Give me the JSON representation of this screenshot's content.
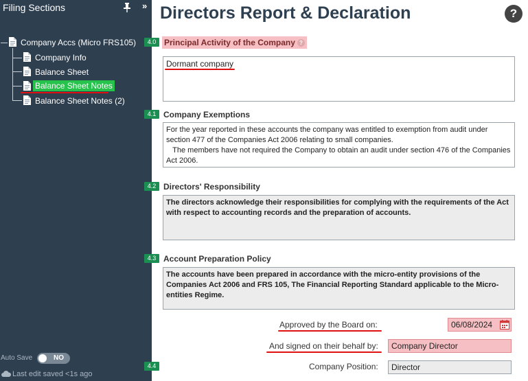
{
  "sidebar": {
    "title": "Filing Sections",
    "collapse_glyph": "»",
    "root": "Company Accs (Micro FRS105)",
    "items": [
      {
        "label": "Company Info"
      },
      {
        "label": "Balance Sheet"
      },
      {
        "label": "Balance Sheet Notes",
        "selected": true
      },
      {
        "label": "Balance Sheet Notes (2)"
      }
    ],
    "auto_save_label": "Auto Save",
    "auto_save_state": "NO",
    "last_saved": "Last edit saved <1s ago"
  },
  "header": {
    "title": "Directors Report & Declaration",
    "help_glyph": "?"
  },
  "sections": [
    {
      "num": "4.0",
      "title": "Principal Activity of the Company",
      "value": "Dormant company"
    },
    {
      "num": "4.1",
      "title": "Company Exemptions",
      "value": "For the year reported in these accounts the company was entitled to exemption from audit under section 477 of the Companies Act 2006 relating to small companies.\n   The members have not required the Company to obtain an audit under section 476 of the Companies Act 2006."
    },
    {
      "num": "4.2",
      "title": "Directors' Responsibility",
      "value": "The directors acknowledge their responsibilities for complying with the requirements of the Act with respect to accounting records and the preparation of accounts."
    },
    {
      "num": "4.3",
      "title": "Account Preparation Policy",
      "value": "The accounts have been prepared in accordance with the micro-entity provisions of the Companies Act 2006 and FRS 105, The Financial Reporting Standard applicable to the Micro-entities Regime."
    }
  ],
  "approval": {
    "approved_label": "Approved by the Board on:",
    "approved_date": "06/08/2024",
    "signed_label": "And signed on their behalf by:",
    "signed_value": "Company Director",
    "position_num": "4.4",
    "position_label": "Company Position:",
    "position_value": "Director"
  },
  "colors": {
    "sidebar_bg": "#2e3f4f",
    "badge_green": "#1b8f52",
    "selected_green": "#27c24c",
    "highlight_pink": "#f6bfc3",
    "underline_red": "#e01010"
  }
}
